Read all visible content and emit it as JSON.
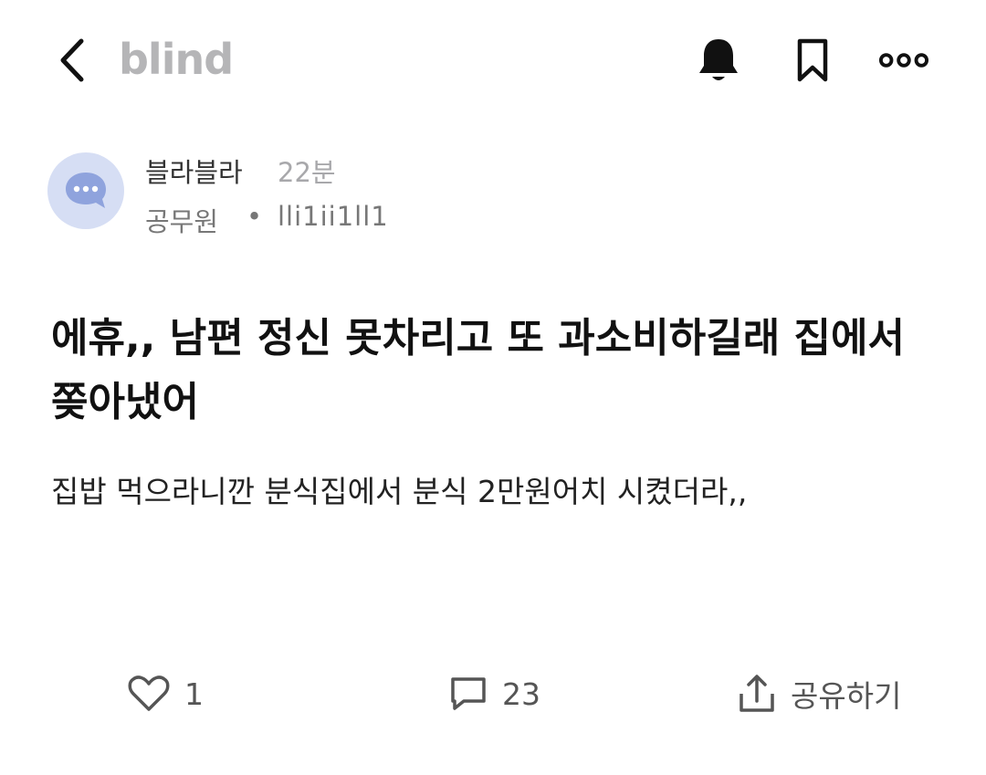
{
  "header": {
    "logo": "blind",
    "icons": [
      "back-arrow-icon",
      "bell-icon",
      "bookmark-icon",
      "more-icon"
    ]
  },
  "post": {
    "author_name": "블라블라",
    "time_ago": "22분",
    "company": "공무원",
    "separator": "•",
    "user_id": "lli1ii1ll1",
    "title": "에휴,, 남편 정신 못차리고 또 과소비하길래 집에서 쫒아냈어",
    "body": "집밥 먹으라니깐 분식집에서 분식 2만원어치 시켰더라,,"
  },
  "actions": {
    "like_count": "1",
    "comment_count": "23",
    "share_label": "공유하기"
  },
  "colors": {
    "logo": "#b5b5b7",
    "avatar_bg": "#d6def4",
    "avatar_bubble": "#8fa3dd"
  }
}
